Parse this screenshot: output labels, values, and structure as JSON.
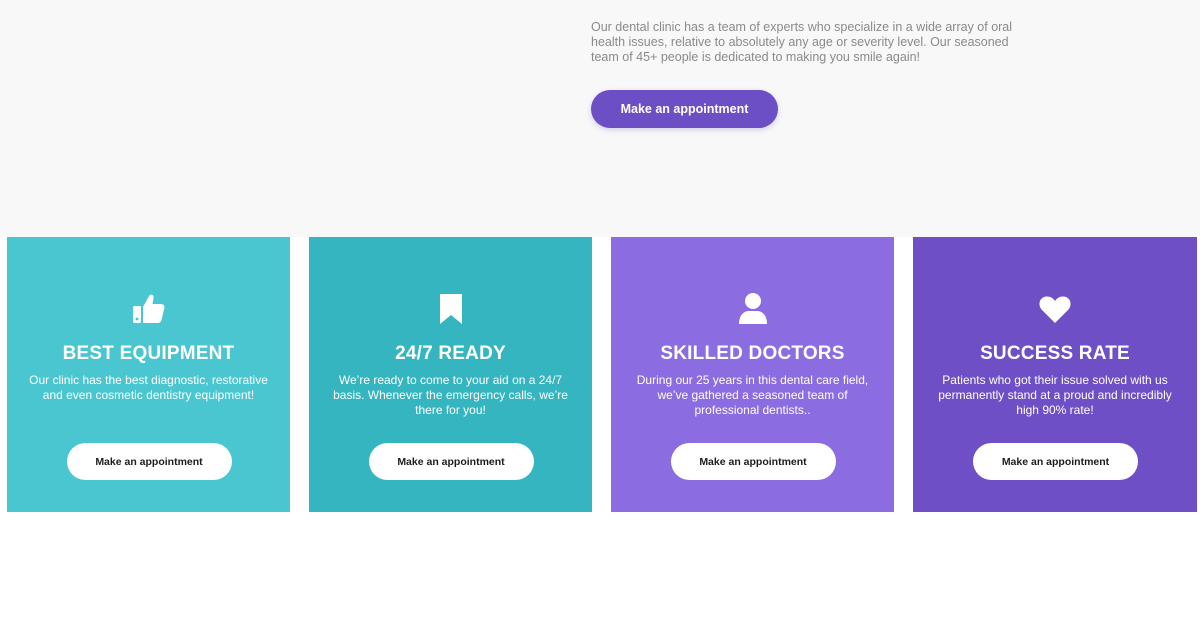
{
  "hero": {
    "intro_text": "Our dental clinic has a team of experts who specialize in a wide array of oral health issues, relative to absolutely any age or severity level. Our seasoned team of 45+ people is dedicated to making you smile again!",
    "button_label": "Make an appointment",
    "button_color": "#6c4fc5"
  },
  "cards": [
    {
      "icon": "thumbs-up-icon",
      "title": "BEST EQUIPMENT",
      "text": "Our clinic has the best diagnostic, restorative and even cosmetic dentistry equipment!",
      "button_label": "Make an appointment",
      "color": "#49c6d0"
    },
    {
      "icon": "bookmark-icon",
      "title": "24/7 READY",
      "text": "We’re ready to come to your aid on a 24/7 basis. Whenever the emergency calls, we’re there for you!",
      "button_label": "Make an appointment",
      "color": "#34b5c0"
    },
    {
      "icon": "user-icon",
      "title": "SKILLED DOCTORS",
      "text": "During our 25 years in this dental care field, we’ve gathered a seasoned team of professional dentists..",
      "button_label": "Make an appointment",
      "color": "#8b6ce1"
    },
    {
      "icon": "heart-icon",
      "title": "SUCCESS RATE",
      "text": "Patients who got their issue solved with us permanently stand at a proud and incredibly high 90% rate!",
      "button_label": "Make an appointment",
      "color": "#6e4fc6"
    }
  ]
}
